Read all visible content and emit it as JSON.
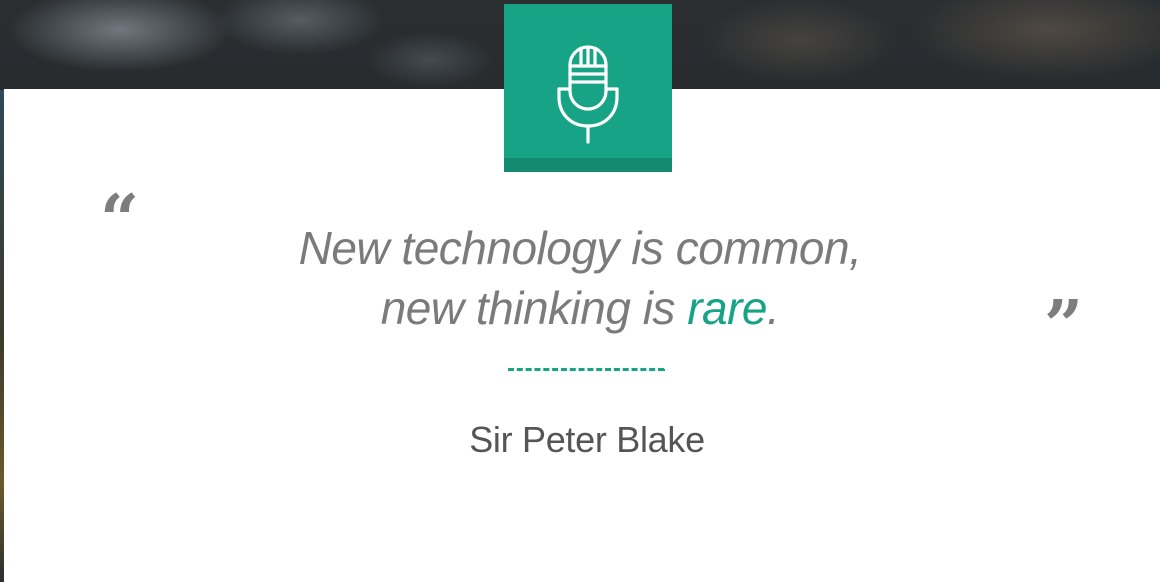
{
  "colors": {
    "accent": "#17a385",
    "accent_dark": "#138a6f",
    "quote_text": "#7b7b7b",
    "author_text": "#555555",
    "quote_marks": "#7d7d7d",
    "card_background": "#ffffff"
  },
  "badge": {
    "icon": "microphone-icon"
  },
  "quote": {
    "open_mark": "“",
    "line1": "New technology is common,",
    "line2_prefix": "new thinking is ",
    "line2_accent": "rare",
    "line2_suffix": ".",
    "close_mark": "”"
  },
  "author": {
    "name": "Sir Peter Blake"
  }
}
